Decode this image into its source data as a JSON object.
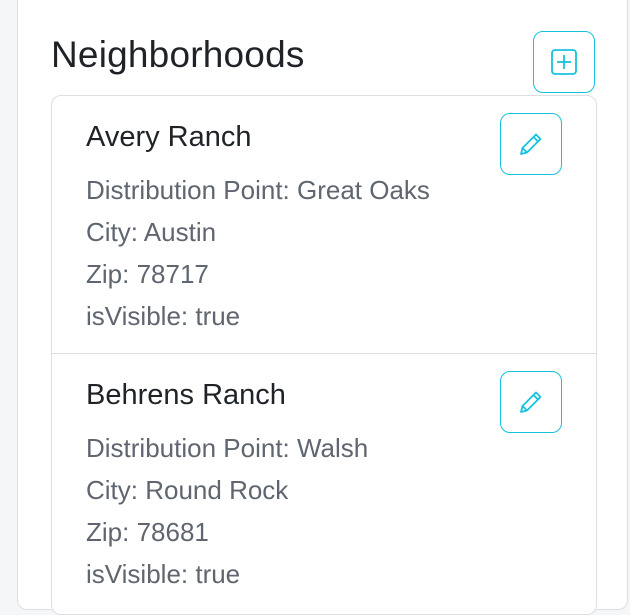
{
  "panel": {
    "title": "Neighborhoods"
  },
  "neighborhoods": [
    {
      "name": "Avery Ranch",
      "distribution_point": "Distribution Point: Great Oaks",
      "city": "City: Austin",
      "zip": "Zip: 78717",
      "visible": "isVisible: true"
    },
    {
      "name": "Behrens Ranch",
      "distribution_point": "Distribution Point: Walsh",
      "city": "City: Round Rock",
      "zip": "Zip: 78681",
      "visible": "isVisible: true"
    }
  ],
  "icons": {
    "add": "plus-square-icon",
    "edit": "pencil-icon"
  },
  "colors": {
    "accent": "#17c2de",
    "text_primary": "#1f2328",
    "text_secondary": "#5f6670",
    "border": "#dcdfe3"
  }
}
